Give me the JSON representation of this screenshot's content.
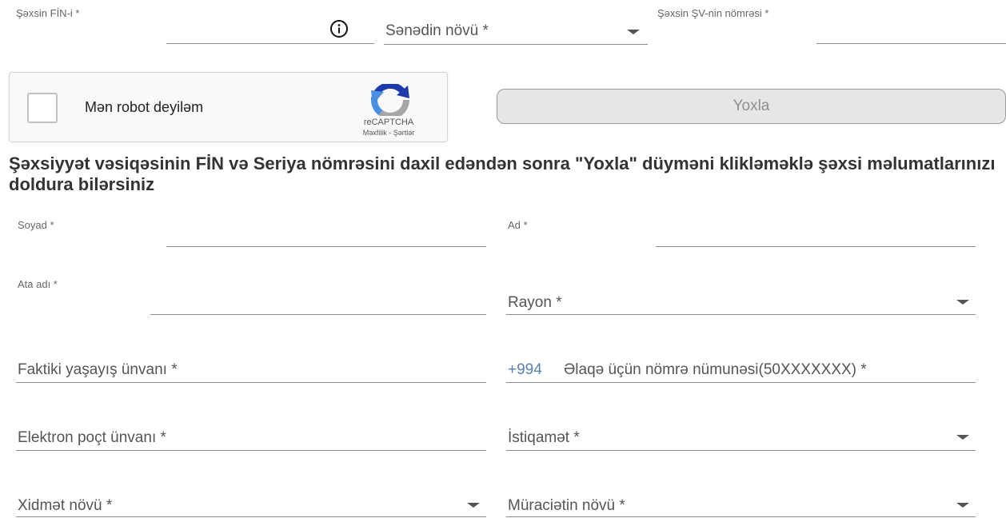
{
  "top": {
    "fin_label": "Şəxsin FİN-i *",
    "doc_type_placeholder": "Sənədin növü *",
    "id_number_label": "Şəxsin ŞV-nin nömrəsi *"
  },
  "recaptcha": {
    "checkbox_label": "Mən robot deyiləm",
    "brand": "reCAPTCHA",
    "privacy": "Məxfilik",
    "separator": " - ",
    "terms": "Şərtlər"
  },
  "check_button": {
    "label": "Yoxla"
  },
  "info_text": "Şəxsiyyət vəsiqəsinin FİN və Seriya nömrəsini daxil edəndən sonra \"Yoxla\" düyməni klikləməklə şəxsi məlumatlarınızı doldura bilərsiniz",
  "form": {
    "surname_label": "Soyad *",
    "name_label": "Ad *",
    "patronymic_label": "Ata adı *",
    "district_placeholder": "Rayon *",
    "address_placeholder": "Faktiki yaşayış ünvanı *",
    "phone_prefix": "+994",
    "phone_placeholder": "Əlaqə üçün nömrə nümunəsi(50XXXXXXX) *",
    "email_placeholder": "Elektron poçt ünvanı *",
    "direction_placeholder": "İstiqamət *",
    "service_type_placeholder": "Xidmət növü *",
    "application_type_placeholder": "Müraciətin növü *"
  },
  "colors": {
    "phone_prefix": "#5b7fb0",
    "recaptcha_blue": "#4a90e2",
    "recaptcha_dark": "#1c3aa9",
    "recaptcha_gray": "#a6a6a6"
  }
}
